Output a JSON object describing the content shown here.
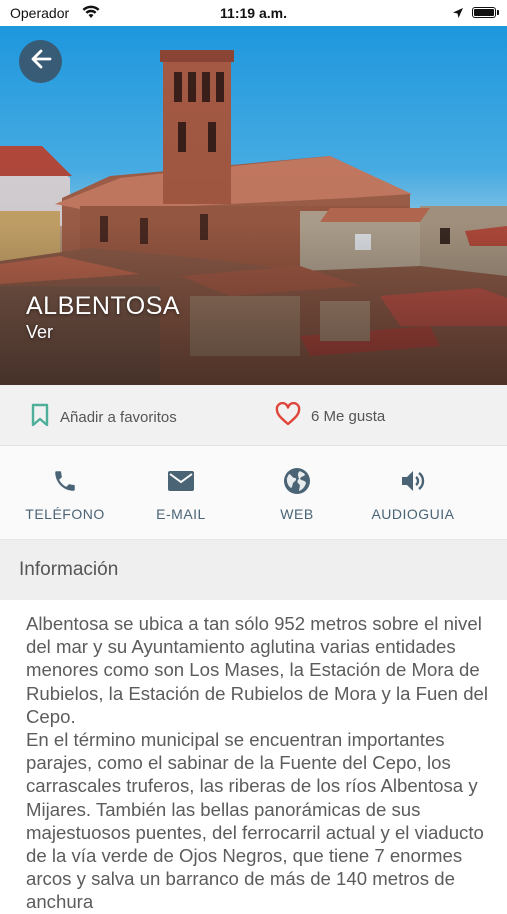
{
  "status_bar": {
    "carrier": "Operador",
    "time": "11:19 a.m."
  },
  "hero": {
    "title": "ALBENTOSA",
    "subtitle": "Ver"
  },
  "actions": {
    "favorite_label": "Añadir a favoritos",
    "likes_label": "6 Me gusta"
  },
  "contacts": [
    {
      "label": "TELÉFONO",
      "icon": "phone-icon"
    },
    {
      "label": "E-MAIL",
      "icon": "mail-icon"
    },
    {
      "label": "WEB",
      "icon": "globe-icon"
    },
    {
      "label": "AUDIOGUIA",
      "icon": "speaker-icon"
    }
  ],
  "section": {
    "title": "Información"
  },
  "info": {
    "text": "Albentosa se ubica a tan sólo 952 metros sobre el nivel del mar y su Ayuntamiento aglutina varias entidades menores como son Los Mases, la Estación de Mora de Rubielos, la Estación de Rubielos de Mora y la Fuen del Cepo.\nEn el término municipal se encuentran importantes parajes, como el sabinar de la Fuente del Cepo, los carrascales truferos, las riberas de los ríos Albentosa y Mijares. También las bellas panorámicas de sus majestuosos puentes, del ferrocarril actual y el viaducto de la vía verde de Ojos Negros, que tiene 7 enormes arcos y salva un barranco de más de 140 metros de anchura"
  },
  "colors": {
    "accent_teal": "#4fae9a",
    "heart_red": "#e0453a",
    "icon_blue": "#4a6476"
  }
}
